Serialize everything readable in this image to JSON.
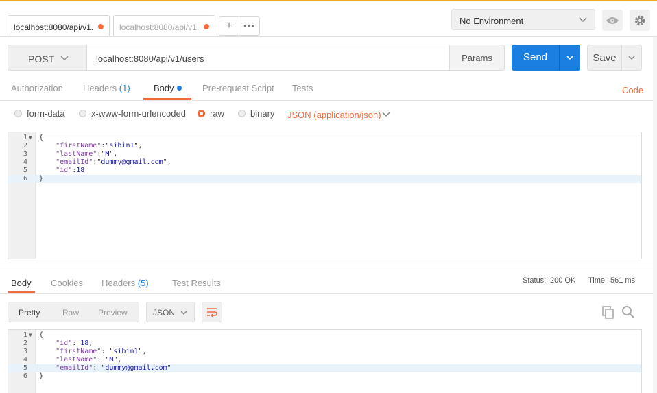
{
  "tabs": [
    {
      "label": "localhost:8080/api/v1.",
      "active": true
    },
    {
      "label": "localhost:8080/api/v1.",
      "active": false
    }
  ],
  "environment": {
    "selected": "No Environment"
  },
  "request": {
    "method": "POST",
    "url": "localhost:8080/api/v1/users",
    "params_label": "Params",
    "send_label": "Send",
    "save_label": "Save"
  },
  "request_tabs": {
    "authorization": "Authorization",
    "headers": "Headers",
    "headers_count": "(1)",
    "body": "Body",
    "prerequest": "Pre-request Script",
    "tests": "Tests",
    "code": "Code"
  },
  "body_types": {
    "form_data": "form-data",
    "urlencoded": "x-www-form-urlencoded",
    "raw": "raw",
    "binary": "binary",
    "content_type": "JSON (application/json)"
  },
  "request_body": {
    "line1": "{",
    "key1": "\"firstName\"",
    "val1": "\"sibin1\"",
    "key2": "\"lastName\"",
    "val2": "\"M\"",
    "key3": "\"emailId\"",
    "val3": "\"dummy@gmail.com\"",
    "key4": "\"id\"",
    "val4": "18",
    "line6": "}"
  },
  "response_tabs": {
    "body": "Body",
    "cookies": "Cookies",
    "headers": "Headers",
    "headers_count": "(5)",
    "test_results": "Test Results"
  },
  "status": {
    "status_label": "Status:",
    "status_value": "200 OK",
    "time_label": "Time:",
    "time_value": "561 ms"
  },
  "response_view": {
    "pretty": "Pretty",
    "raw": "Raw",
    "preview": "Preview",
    "format": "JSON"
  },
  "response_body": {
    "line1": "{",
    "key1": "\"id\"",
    "val1": "18",
    "key2": "\"firstName\"",
    "val2": "\"sibin1\"",
    "key3": "\"lastName\"",
    "val3": "\"M\"",
    "key4": "\"emailId\"",
    "val4": "\"dummy@gmail.com\"",
    "line6": "}"
  },
  "colors": {
    "accent": "#f26b3a",
    "primary": "#1a7fe0",
    "topline": "#f5a623"
  }
}
